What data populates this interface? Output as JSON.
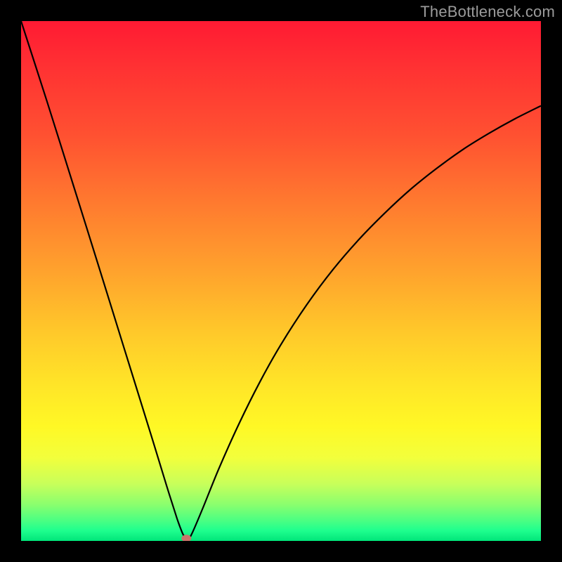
{
  "watermark": "TheBottleneck.com",
  "chart_data": {
    "type": "line",
    "title": "",
    "xlabel": "",
    "ylabel": "",
    "xlim": [
      0,
      100
    ],
    "ylim": [
      0,
      100
    ],
    "grid": false,
    "legend": null,
    "series": [
      {
        "name": "bottleneck-curve",
        "x": [
          0,
          5,
          10,
          15,
          20,
          25,
          28,
          30,
          31,
          31.5,
          32,
          33,
          35,
          38,
          42,
          46,
          50,
          55,
          60,
          65,
          70,
          75,
          80,
          85,
          90,
          95,
          100
        ],
        "values": [
          100,
          84.5,
          68.6,
          52.6,
          36.5,
          20.4,
          10.6,
          4.3,
          1.6,
          0.7,
          0,
          1.7,
          6.4,
          13.8,
          22.7,
          30.7,
          37.8,
          45.5,
          52.2,
          58.0,
          63.1,
          67.7,
          71.7,
          75.3,
          78.4,
          81.2,
          83.7
        ]
      }
    ],
    "marker": {
      "name": "bottleneck-point",
      "x": 31.8,
      "y": 0.5,
      "color": "#c9746a"
    },
    "background_gradient": {
      "top": "#ff1a33",
      "bottom": "#00e57a",
      "stops": [
        "#ff1a33",
        "#ff7a2f",
        "#ffe528",
        "#8aff6e",
        "#00e57a"
      ]
    }
  }
}
